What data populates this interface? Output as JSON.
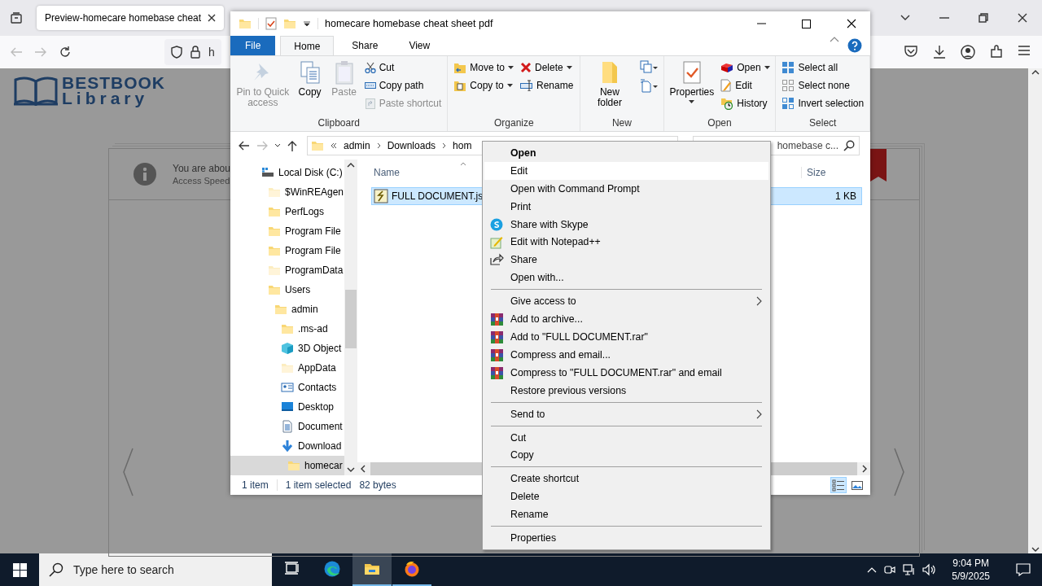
{
  "browser": {
    "tab_title": "Preview-homecare homebase cheat",
    "url": "h"
  },
  "page": {
    "logo": {
      "line_1": "BESTBOOK",
      "line_2": "Library"
    },
    "notice": {
      "title": "You are abou",
      "subtitle": "Access Speed"
    }
  },
  "explorer": {
    "title": "homecare homebase cheat sheet pdf",
    "ribbon_tabs": [
      {
        "label": "File",
        "kind": "backstage",
        "selected": false
      },
      {
        "label": "Home",
        "kind": "tab",
        "selected": true
      },
      {
        "label": "Share",
        "kind": "tab",
        "selected": false
      },
      {
        "label": "View",
        "kind": "tab",
        "selected": false
      }
    ],
    "ribbon_groups": [
      {
        "label": "Clipboard",
        "columns": [
          [
            {
              "label": "Pin to Quick access",
              "kind": "large",
              "disabled": true,
              "dropdown": false
            }
          ],
          [
            {
              "label": "Copy",
              "kind": "large",
              "disabled": false,
              "dropdown": false
            }
          ],
          [
            {
              "label": "Paste",
              "kind": "large",
              "disabled": true,
              "dropdown": false
            }
          ],
          [
            {
              "label": "Cut",
              "kind": "small",
              "disabled": false,
              "dropdown": false
            },
            {
              "label": "Copy path",
              "kind": "small",
              "disabled": false,
              "dropdown": false
            },
            {
              "label": "Paste shortcut",
              "kind": "small",
              "disabled": true,
              "dropdown": false
            }
          ]
        ]
      },
      {
        "label": "Organize",
        "columns": [
          [
            {
              "label": "Move to",
              "kind": "small",
              "disabled": false,
              "dropdown": true
            },
            {
              "label": "Copy to",
              "kind": "small",
              "disabled": false,
              "dropdown": true
            }
          ],
          [
            {
              "label": "Delete",
              "kind": "small",
              "disabled": false,
              "dropdown": true
            },
            {
              "label": "Rename",
              "kind": "small",
              "disabled": false,
              "dropdown": false
            }
          ]
        ]
      },
      {
        "label": "New",
        "columns": [
          [
            {
              "label": "New folder",
              "kind": "large",
              "disabled": false,
              "dropdown": false
            }
          ],
          [
            {
              "kind": "icon",
              "disabled": false,
              "dropdown": true
            },
            {
              "kind": "icon",
              "disabled": false,
              "dropdown": true
            }
          ]
        ]
      },
      {
        "label": "Open",
        "columns": [
          [
            {
              "label": "Properties",
              "kind": "large",
              "disabled": false,
              "dropdown": true
            }
          ],
          [
            {
              "label": "Open",
              "kind": "small",
              "disabled": false,
              "dropdown": true
            },
            {
              "label": "Edit",
              "kind": "small",
              "disabled": false,
              "dropdown": false
            },
            {
              "label": "History",
              "kind": "small",
              "disabled": false,
              "dropdown": false
            }
          ]
        ]
      },
      {
        "label": "Select",
        "columns": [
          [
            {
              "label": "Select all",
              "kind": "small",
              "disabled": false,
              "dropdown": false
            },
            {
              "label": "Select none",
              "kind": "small",
              "disabled": false,
              "dropdown": false
            },
            {
              "label": "Invert selection",
              "kind": "small",
              "disabled": false,
              "dropdown": false
            }
          ]
        ]
      }
    ],
    "address": {
      "crumbs": [
        "admin",
        "Downloads",
        "hom"
      ]
    },
    "search": {
      "value": "homebase c..."
    },
    "nav_tree": [
      {
        "label": "Local Disk (C:)",
        "kind": "drive",
        "hidden": false,
        "selected": false,
        "children": [
          {
            "label": "$WinREAgen",
            "kind": "folder",
            "hidden": true,
            "selected": false
          },
          {
            "label": "PerfLogs",
            "kind": "folder",
            "hidden": false,
            "selected": false
          },
          {
            "label": "Program File",
            "kind": "folder",
            "hidden": false,
            "selected": false
          },
          {
            "label": "Program File",
            "kind": "folder",
            "hidden": false,
            "selected": false
          },
          {
            "label": "ProgramData",
            "kind": "folder",
            "hidden": true,
            "selected": false
          },
          {
            "label": "Users",
            "kind": "folder",
            "hidden": false,
            "selected": false,
            "children": [
              {
                "label": "admin",
                "kind": "folder",
                "hidden": false,
                "selected": false,
                "children": [
                  {
                    "label": ".ms-ad",
                    "kind": "folder",
                    "hidden": false,
                    "selected": false
                  },
                  {
                    "label": "3D Object",
                    "kind": "objects",
                    "hidden": false,
                    "selected": false
                  },
                  {
                    "label": "AppData",
                    "kind": "folder",
                    "hidden": true,
                    "selected": false
                  },
                  {
                    "label": "Contacts",
                    "kind": "contacts",
                    "hidden": false,
                    "selected": false
                  },
                  {
                    "label": "Desktop",
                    "kind": "desktop",
                    "hidden": false,
                    "selected": false
                  },
                  {
                    "label": "Document",
                    "kind": "documents",
                    "hidden": false,
                    "selected": false
                  },
                  {
                    "label": "Download",
                    "kind": "downloads",
                    "hidden": false,
                    "selected": false,
                    "children": [
                      {
                        "label": "homecar",
                        "kind": "folder",
                        "hidden": false,
                        "selected": true
                      }
                    ]
                  }
                ]
              }
            ]
          }
        ]
      }
    ],
    "file_list": {
      "columns": [
        "Name",
        "Size"
      ],
      "rows": [
        {
          "name": "FULL DOCUMENT.js",
          "size": "1 KB",
          "selected": true
        }
      ]
    },
    "status_bar": {
      "count": "1 item",
      "selection": "1 item selected",
      "size": "82 bytes"
    },
    "view_buttons": [
      {
        "kind": "details",
        "selected": true
      },
      {
        "kind": "thumbnails",
        "selected": false
      }
    ]
  },
  "context_menu": [
    {
      "kind": "item",
      "label": "Open",
      "default": true,
      "selected": false,
      "submenu": false
    },
    {
      "kind": "item",
      "label": "Edit",
      "default": false,
      "selected": true,
      "submenu": false
    },
    {
      "kind": "item",
      "label": "Open with Command Prompt",
      "default": false,
      "selected": false,
      "submenu": false
    },
    {
      "kind": "item",
      "label": "Print",
      "default": false,
      "selected": false,
      "submenu": false
    },
    {
      "kind": "item",
      "label": "Share with Skype",
      "default": false,
      "selected": false,
      "submenu": false
    },
    {
      "kind": "item",
      "label": "Edit with Notepad++",
      "default": false,
      "selected": false,
      "submenu": false
    },
    {
      "kind": "item",
      "label": "Share",
      "default": false,
      "selected": false,
      "submenu": false
    },
    {
      "kind": "item",
      "label": "Open with...",
      "default": false,
      "selected": false,
      "submenu": false
    },
    {
      "kind": "separator"
    },
    {
      "kind": "item",
      "label": "Give access to",
      "default": false,
      "selected": false,
      "submenu": true
    },
    {
      "kind": "item",
      "label": "Add to archive...",
      "default": false,
      "selected": false,
      "submenu": false
    },
    {
      "kind": "item",
      "label": "Add to \"FULL DOCUMENT.rar\"",
      "default": false,
      "selected": false,
      "submenu": false
    },
    {
      "kind": "item",
      "label": "Compress and email...",
      "default": false,
      "selected": false,
      "submenu": false
    },
    {
      "kind": "item",
      "label": "Compress to \"FULL DOCUMENT.rar\" and email",
      "default": false,
      "selected": false,
      "submenu": false
    },
    {
      "kind": "item",
      "label": "Restore previous versions",
      "default": false,
      "selected": false,
      "submenu": false
    },
    {
      "kind": "separator"
    },
    {
      "kind": "item",
      "label": "Send to",
      "default": false,
      "selected": false,
      "submenu": true
    },
    {
      "kind": "separator"
    },
    {
      "kind": "item",
      "label": "Cut",
      "default": false,
      "selected": false,
      "submenu": false
    },
    {
      "kind": "item",
      "label": "Copy",
      "default": false,
      "selected": false,
      "submenu": false
    },
    {
      "kind": "separator"
    },
    {
      "kind": "item",
      "label": "Create shortcut",
      "default": false,
      "selected": false,
      "submenu": false
    },
    {
      "kind": "item",
      "label": "Delete",
      "default": false,
      "selected": false,
      "submenu": false
    },
    {
      "kind": "item",
      "label": "Rename",
      "default": false,
      "selected": false,
      "submenu": false
    },
    {
      "kind": "separator"
    },
    {
      "kind": "item",
      "label": "Properties",
      "default": false,
      "selected": false,
      "submenu": false
    }
  ],
  "taskbar": {
    "search_placeholder": "Type here to search",
    "apps": [
      {
        "kind": "taskview",
        "selected": false,
        "running": false
      },
      {
        "kind": "edge",
        "selected": false,
        "running": false
      },
      {
        "kind": "explorer",
        "selected": true,
        "running": true
      },
      {
        "kind": "firefox",
        "selected": false,
        "running": true
      }
    ],
    "time": "9:04 PM",
    "date": "5/9/2025"
  }
}
